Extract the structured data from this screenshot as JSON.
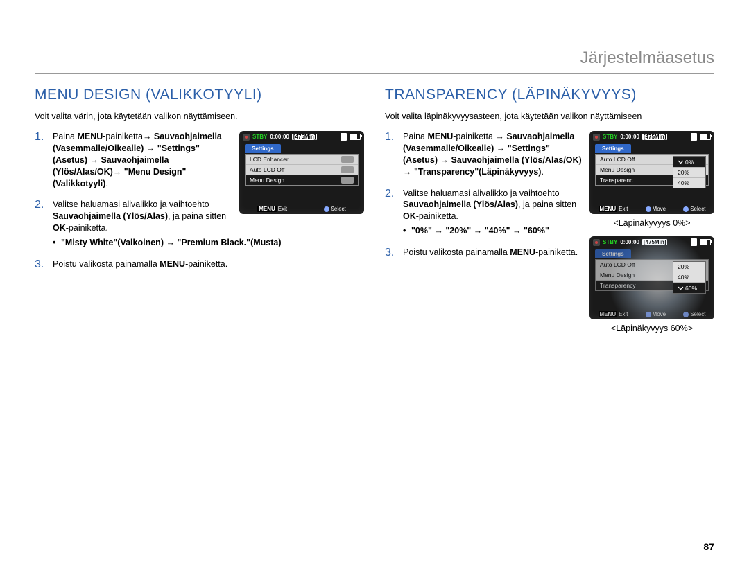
{
  "page": {
    "header": "Järjestelmäasetus",
    "number": "87"
  },
  "left": {
    "title": "MENU DESIGN (VALIKKOTYYLI)",
    "intro": "Voit valita värin, jota käytetään valikon näyttämiseen.",
    "step1_a": "Paina ",
    "step1_b": "MENU",
    "step1_c": "-painiketta→ ",
    "step1_d": "Sauvaohjaimella (Vasemmalle/Oikealle) → \"Settings\"(Asetus) → Sauvaohjaimella (Ylös/Alas/OK)→ \"Menu Design\"(Valikkotyyli)",
    "step1_e": ".",
    "step2_a": "Valitse haluamasi alivalikko ja vaihtoehto ",
    "step2_b": "Sauvaohjaimella (Ylös/Alas)",
    "step2_c": ", ja paina sitten ",
    "step2_d": "OK",
    "step2_e": "-painiketta.",
    "step2_bullet": "\"Misty White\"(Valkoinen) → \"Premium Black.\"(Musta)",
    "step3_a": "Poistu valikosta painamalla ",
    "step3_b": "MENU",
    "step3_c": "-painiketta."
  },
  "right": {
    "title": "TRANSPARENCY (LÄPINÄKYVYYS)",
    "intro": "Voit valita läpinäkyvyysasteen, jota käytetään valikon näyttämiseen",
    "step1_a": "Paina ",
    "step1_b": "MENU",
    "step1_c": "-painiketta → ",
    "step1_d": "Sauvaohjaimella (Vasemmalle/Oikealle) → \"Settings\"(Asetus) → Sauvaohjaimella (Ylös/Alas/OK) → \"Transparency\"(Läpinäkyvyys)",
    "step1_e": ".",
    "step2_a": "Valitse haluamasi alivalikko ja vaihtoehto ",
    "step2_b": "Sauvaohjaimella (Ylös/Alas)",
    "step2_c": ", ja paina sitten ",
    "step2_d": "OK",
    "step2_e": "-painiketta.",
    "step2_bullet": "\"0%\" → \"20%\" → \"40%\" → \"60%\"",
    "step3_a": "Poistu valikosta painamalla ",
    "step3_b": "MENU",
    "step3_c": "-painiketta.",
    "caption0": "<Läpinäkyvyys 0%>",
    "caption60": "<Läpinäkyvyys 60%>"
  },
  "cam": {
    "stby": "STBY",
    "time": "0:00:00",
    "remain": "[475Min]",
    "tab": "Settings",
    "exit_tag": "MENU",
    "exit": "Exit",
    "move": "Move",
    "select": "Select",
    "left_rows": [
      "LCD Enhancer",
      "Auto LCD Off",
      "Menu Design"
    ],
    "right_rows": [
      "Auto LCD Off",
      "Menu Design",
      "Transparenc"
    ],
    "popup": [
      "0%",
      "20%",
      "40%"
    ],
    "ghost_rows": [
      "Auto LCD Off",
      "Menu Design",
      "Transparency"
    ],
    "ghost_popup": [
      "20%",
      "40%",
      "60%"
    ]
  }
}
